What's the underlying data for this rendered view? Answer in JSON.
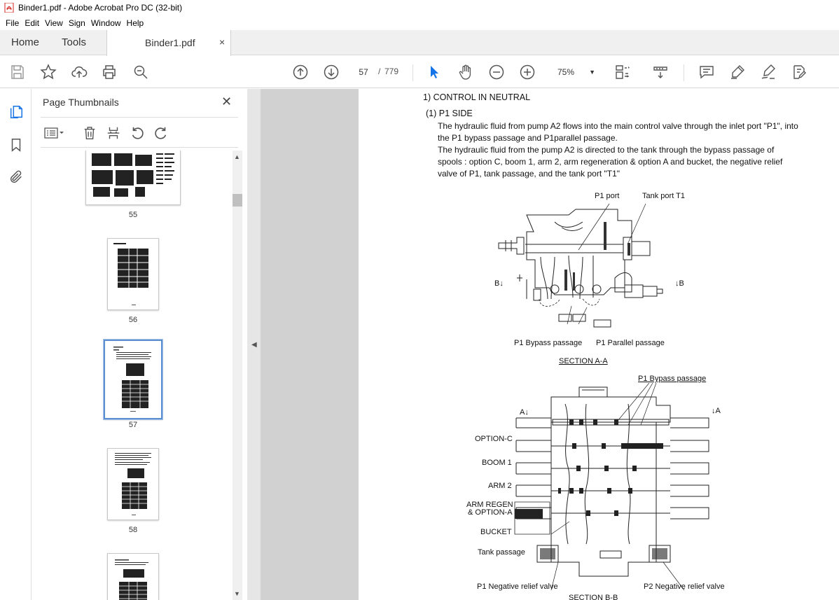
{
  "window": {
    "title": "Binder1.pdf - Adobe Acrobat Pro DC (32-bit)"
  },
  "menu": [
    "File",
    "Edit",
    "View",
    "Sign",
    "Window",
    "Help"
  ],
  "tabs": {
    "home": "Home",
    "tools": "Tools",
    "document": "Binder1.pdf",
    "close_glyph": "×"
  },
  "toolbar": {
    "current_page": "57",
    "separator": "/",
    "total_pages": "779",
    "zoom": "75%"
  },
  "thumbnail_panel": {
    "title": "Page Thumbnails",
    "close_glyph": "✕",
    "pages": [
      "55",
      "56",
      "57",
      "58"
    ],
    "selected_page": "57"
  },
  "document": {
    "heading": "1) CONTROL IN NEUTRAL",
    "subheading": "(1) P1 SIDE",
    "paragraph1_line1": "The hydraulic fluid from pump A2 flows into the main control valve through the inlet port \"P1\", into",
    "paragraph1_line2": "the P1 bypass passage and P1parallel passage.",
    "paragraph2_line1": "The hydraulic fluid from the pump A2 is directed to the tank through the bypass passage of",
    "paragraph2_line2": "spools : option C, boom 1, arm 2, arm regeneration & option A and bucket, the negative relief",
    "paragraph2_line3": "valve of P1, tank passage, and the tank port \"T1\"",
    "diagram1": {
      "p1_port": "P1 port",
      "tank_port": "Tank port  T1",
      "b_left": "B",
      "b_right": "B",
      "p1_bypass": "P1 Bypass passage",
      "p1_parallel": "P1 Parallel passage",
      "section": "SECTION  A-A"
    },
    "diagram2": {
      "p1_bypass": "P1 Bypass passage",
      "a_left": "A",
      "a_right": "A",
      "option_c": "OPTION-C",
      "boom1": "BOOM 1",
      "arm2": "ARM 2",
      "arm_regen": "ARM REGEN",
      "option_a": "& OPTION-A",
      "bucket": "BUCKET",
      "tank_passage": "Tank passage",
      "p1_neg_relief": "P1 Negative relief valve",
      "p2_neg_relief": "P2 Negative relief valve",
      "section": "SECTION  B-B"
    }
  },
  "colors": {
    "selection_blue": "#5a8fd0",
    "cursor_blue": "#1473e6",
    "acrobat_red": "#d4261f"
  }
}
